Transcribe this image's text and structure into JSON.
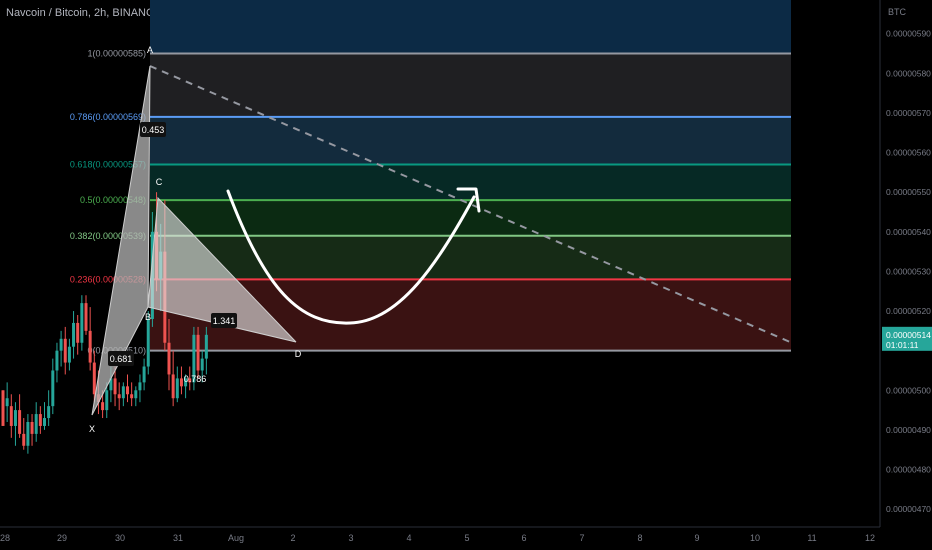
{
  "header": {
    "title": "Navcoin / Bitcoin, 2h, BINANCE"
  },
  "price_axis": {
    "unit": "BTC",
    "ticks": [
      "0.00000590",
      "0.00000580",
      "0.00000570",
      "0.00000560",
      "0.00000550",
      "0.00000540",
      "0.00000530",
      "0.00000520",
      "0.00000500",
      "0.00000490",
      "0.00000480",
      "0.00000470"
    ],
    "current_price": "0.00000514",
    "countdown": "01:01:11",
    "current_color": "#26a69a"
  },
  "time_axis": {
    "ticks": [
      "28",
      "29",
      "30",
      "31",
      "Aug",
      "2",
      "3",
      "4",
      "5",
      "6",
      "7",
      "8",
      "9",
      "10",
      "11",
      "12"
    ]
  },
  "chart_data": {
    "type": "candlestick",
    "symbol": "Navcoin / Bitcoin, 2h, BINANCE",
    "y_unit": "BTC",
    "ylim": [
      4.655e-06,
      5.985e-06
    ],
    "fibonacci": [
      {
        "level": "1",
        "price": 5.85e-06,
        "label": "1(0.00000585)",
        "color": "#9598a1"
      },
      {
        "level": "0.786",
        "price": 5.69e-06,
        "label": "0.786(0.00000569)",
        "color": "#5b9cf6"
      },
      {
        "level": "0.618",
        "price": 5.57e-06,
        "label": "0.618(0.00000557)",
        "color": "#089981"
      },
      {
        "level": "0.5",
        "price": 5.48e-06,
        "label": "0.5(0.00000548)",
        "color": "#4caf50"
      },
      {
        "level": "0.382",
        "price": 5.39e-06,
        "label": "0.382(0.00000539)",
        "color": "#81c784"
      },
      {
        "level": "0.236",
        "price": 5.28e-06,
        "label": "0.236(0.00000528)",
        "color": "#f23645"
      },
      {
        "level": "0",
        "price": 5.1e-06,
        "label": "0(0.00000510)",
        "color": "#9598a1"
      }
    ],
    "harmonic_pattern": {
      "points": [
        {
          "name": "X",
          "price": 4.93e-06
        },
        {
          "name": "A",
          "price": 5.85e-06
        },
        {
          "name": "B",
          "price": 5.19e-06
        },
        {
          "name": "C",
          "price": 5.48e-06
        },
        {
          "name": "D",
          "price": 5.1e-06
        }
      ],
      "ratios": [
        "0.453",
        "0.681",
        "1.341",
        "0.786"
      ]
    },
    "candles": [
      [
        5e-06,
        5e-06,
        4.96e-06,
        4.91e-06
      ],
      [
        4.96e-06,
        5.02e-06,
        4.92e-06,
        4.98e-06
      ],
      [
        4.96e-06,
        4.99e-06,
        4.88e-06,
        4.91e-06
      ],
      [
        4.91e-06,
        4.97e-06,
        4.86e-06,
        4.95e-06
      ],
      [
        4.95e-06,
        4.99e-06,
        4.88e-06,
        4.89e-06
      ],
      [
        4.89e-06,
        4.93e-06,
        4.85e-06,
        4.86e-06
      ],
      [
        4.86e-06,
        4.94e-06,
        4.84e-06,
        4.92e-06
      ],
      [
        4.92e-06,
        4.94e-06,
        4.86e-06,
        4.89e-06
      ],
      [
        4.89e-06,
        4.97e-06,
        4.87e-06,
        4.94e-06
      ],
      [
        4.94e-06,
        4.96e-06,
        4.89e-06,
        4.91e-06
      ],
      [
        4.91e-06,
        4.97e-06,
        4.9e-06,
        4.93e-06
      ],
      [
        4.93e-06,
        5e-06,
        4.91e-06,
        4.96e-06
      ],
      [
        4.96e-06,
        5.08e-06,
        4.94e-06,
        5.05e-06
      ],
      [
        5.05e-06,
        5.12e-06,
        5.02e-06,
        5.1e-06
      ],
      [
        5.1e-06,
        5.15e-06,
        5.06e-06,
        5.13e-06
      ],
      [
        5.13e-06,
        5.16e-06,
        5.04e-06,
        5.07e-06
      ],
      [
        5.07e-06,
        5.13e-06,
        5.05e-06,
        5.11e-06
      ],
      [
        5.11e-06,
        5.2e-06,
        5.08e-06,
        5.17e-06
      ],
      [
        5.17e-06,
        5.19e-06,
        5.09e-06,
        5.12e-06
      ],
      [
        5.12e-06,
        5.24e-06,
        5.1e-06,
        5.22e-06
      ],
      [
        5.22e-06,
        5.24e-06,
        5.14e-06,
        5.15e-06
      ],
      [
        5.15e-06,
        5.21e-06,
        5.05e-06,
        5.07e-06
      ],
      [
        5.07e-06,
        5.1e-06,
        4.97e-06,
        4.99e-06
      ],
      [
        4.99e-06,
        5.05e-06,
        4.94e-06,
        4.97e-06
      ],
      [
        4.97e-06,
        5e-06,
        4.93e-06,
        4.95e-06
      ],
      [
        4.95e-06,
        5.02e-06,
        4.93e-06,
        5e-06
      ],
      [
        5e-06,
        5.06e-06,
        4.97e-06,
        5.03e-06
      ],
      [
        5.03e-06,
        5.06e-06,
        4.96e-06,
        4.99e-06
      ],
      [
        4.99e-06,
        5.02e-06,
        4.95e-06,
        4.98e-06
      ],
      [
        4.98e-06,
        5.02e-06,
        4.96e-06,
        5.01e-06
      ],
      [
        5.01e-06,
        5.04e-06,
        4.97e-06,
        4.99e-06
      ],
      [
        4.99e-06,
        5.02e-06,
        4.96e-06,
        4.98e-06
      ],
      [
        4.98e-06,
        5.01e-06,
        4.96e-06,
        5e-06
      ],
      [
        5e-06,
        5.04e-06,
        4.97e-06,
        5.02e-06
      ],
      [
        5.02e-06,
        5.08e-06,
        5e-06,
        5.06e-06
      ],
      [
        5.06e-06,
        5.2e-06,
        5.04e-06,
        5.18e-06
      ],
      [
        5.18e-06,
        5.45e-06,
        5.16e-06,
        5.4e-06
      ],
      [
        5.4e-06,
        5.5e-06,
        5.25e-06,
        5.28e-06
      ],
      [
        5.28e-06,
        5.42e-06,
        5.2e-06,
        5.35e-06
      ],
      [
        5.35e-06,
        5.48e-06,
        5.1e-06,
        5.12e-06
      ],
      [
        5.12e-06,
        5.18e-06,
        5e-06,
        5.04e-06
      ],
      [
        5.04e-06,
        5.1e-06,
        4.96e-06,
        4.98e-06
      ],
      [
        4.98e-06,
        5.06e-06,
        4.97e-06,
        5.03e-06
      ],
      [
        5.03e-06,
        5.06e-06,
        4.99e-06,
        5.01e-06
      ],
      [
        5.01e-06,
        5.04e-06,
        4.98e-06,
        5.03e-06
      ],
      [
        5.03e-06,
        5.06e-06,
        5e-06,
        5.02e-06
      ],
      [
        5.02e-06,
        5.16e-06,
        5e-06,
        5.14e-06
      ],
      [
        5.14e-06,
        5.16e-06,
        5.03e-06,
        5.05e-06
      ],
      [
        5.05e-06,
        5.1e-06,
        5.02e-06,
        5.08e-06
      ],
      [
        5.08e-06,
        5.16e-06,
        5.04e-06,
        5.14e-06
      ]
    ]
  }
}
